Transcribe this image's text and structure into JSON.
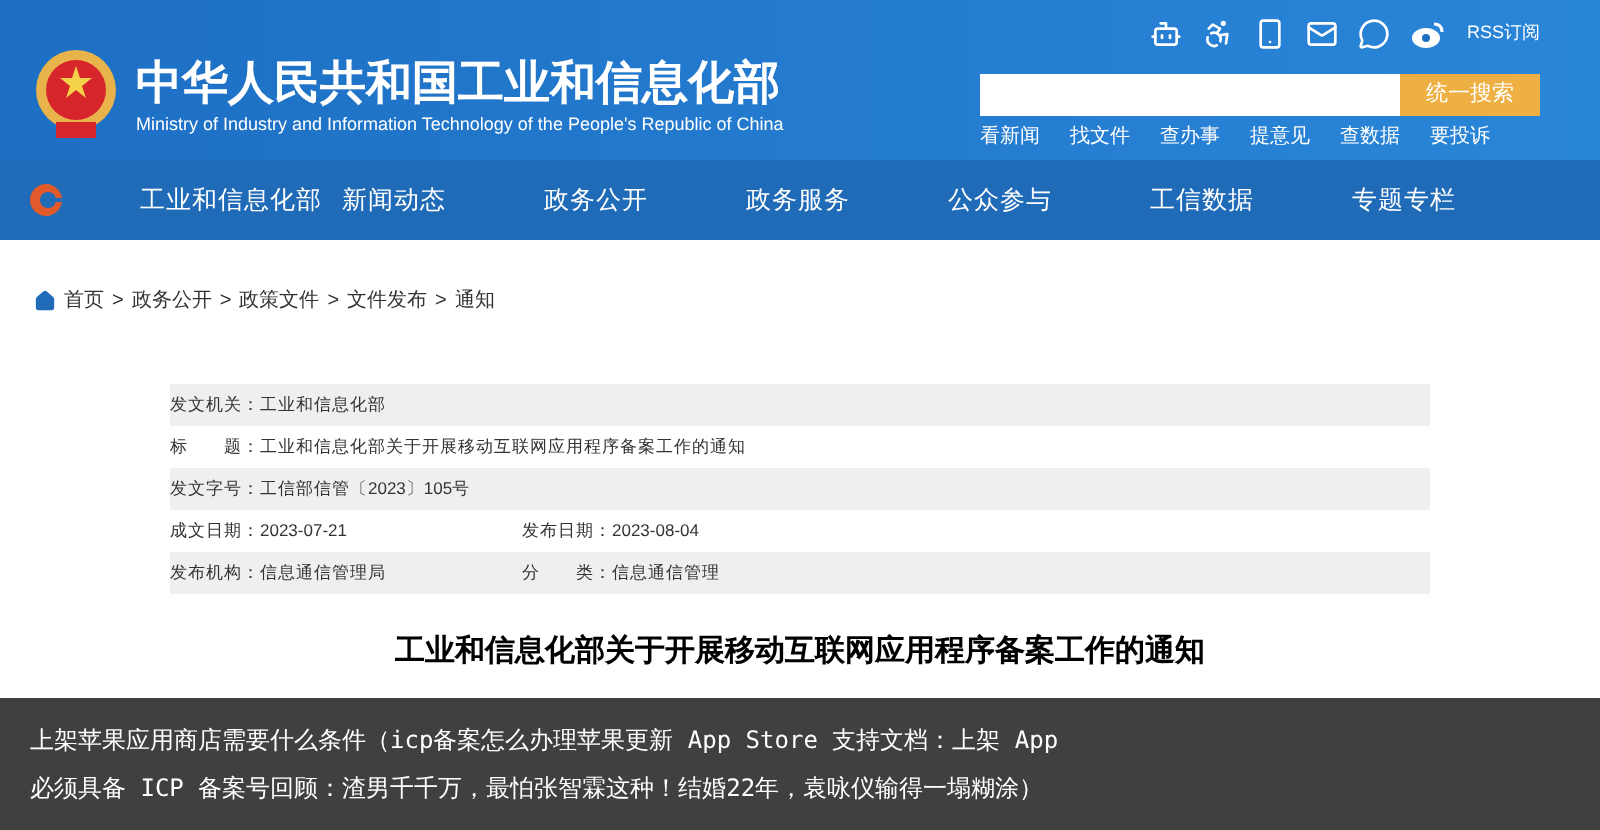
{
  "header": {
    "title": "中华人民共和国工业和信息化部",
    "subtitle": "Ministry of Industry and Information Technology of the People's Republic of China",
    "rss": "RSS订阅",
    "search": {
      "button": "统一搜索"
    },
    "quick_links": [
      "看新闻",
      "找文件",
      "查办事",
      "提意见",
      "查数据",
      "要投诉"
    ]
  },
  "nav": {
    "items": [
      "工业和信息化部",
      "新闻动态",
      "政务公开",
      "政务服务",
      "公众参与",
      "工信数据",
      "专题专栏"
    ]
  },
  "breadcrumb": {
    "separator": ">",
    "items": [
      "首页",
      "政务公开",
      "政策文件",
      "文件发布",
      "通知"
    ]
  },
  "meta_rows": [
    {
      "fields": [
        {
          "label": "发文机关：",
          "value": "工业和信息化部"
        }
      ]
    },
    {
      "fields": [
        {
          "label": "标　　题：",
          "value": "工业和信息化部关于开展移动互联网应用程序备案工作的通知"
        }
      ]
    },
    {
      "fields": [
        {
          "label": "发文字号：",
          "value": "工信部信管〔2023〕105号"
        }
      ]
    },
    {
      "fields": [
        {
          "label": "成文日期：",
          "value": "2023-07-21"
        },
        {
          "label": "发布日期：",
          "value": "2023-08-04"
        }
      ]
    },
    {
      "fields": [
        {
          "label": "发布机构：",
          "value": "信息通信管理局"
        },
        {
          "label": "分　　类：",
          "value": "信息通信管理"
        }
      ]
    }
  ],
  "document": {
    "title": "工业和信息化部关于开展移动互联网应用程序备案工作的通知"
  },
  "caption_lines": [
    "上架苹果应用商店需要什么条件（icp备案怎么办理苹果更新 App Store 支持文档：上架 App",
    "必须具备 ICP 备案号回顾：渣男千千万，最怕张智霖这种！结婚22年，袁咏仪输得一塌糊涂）"
  ]
}
